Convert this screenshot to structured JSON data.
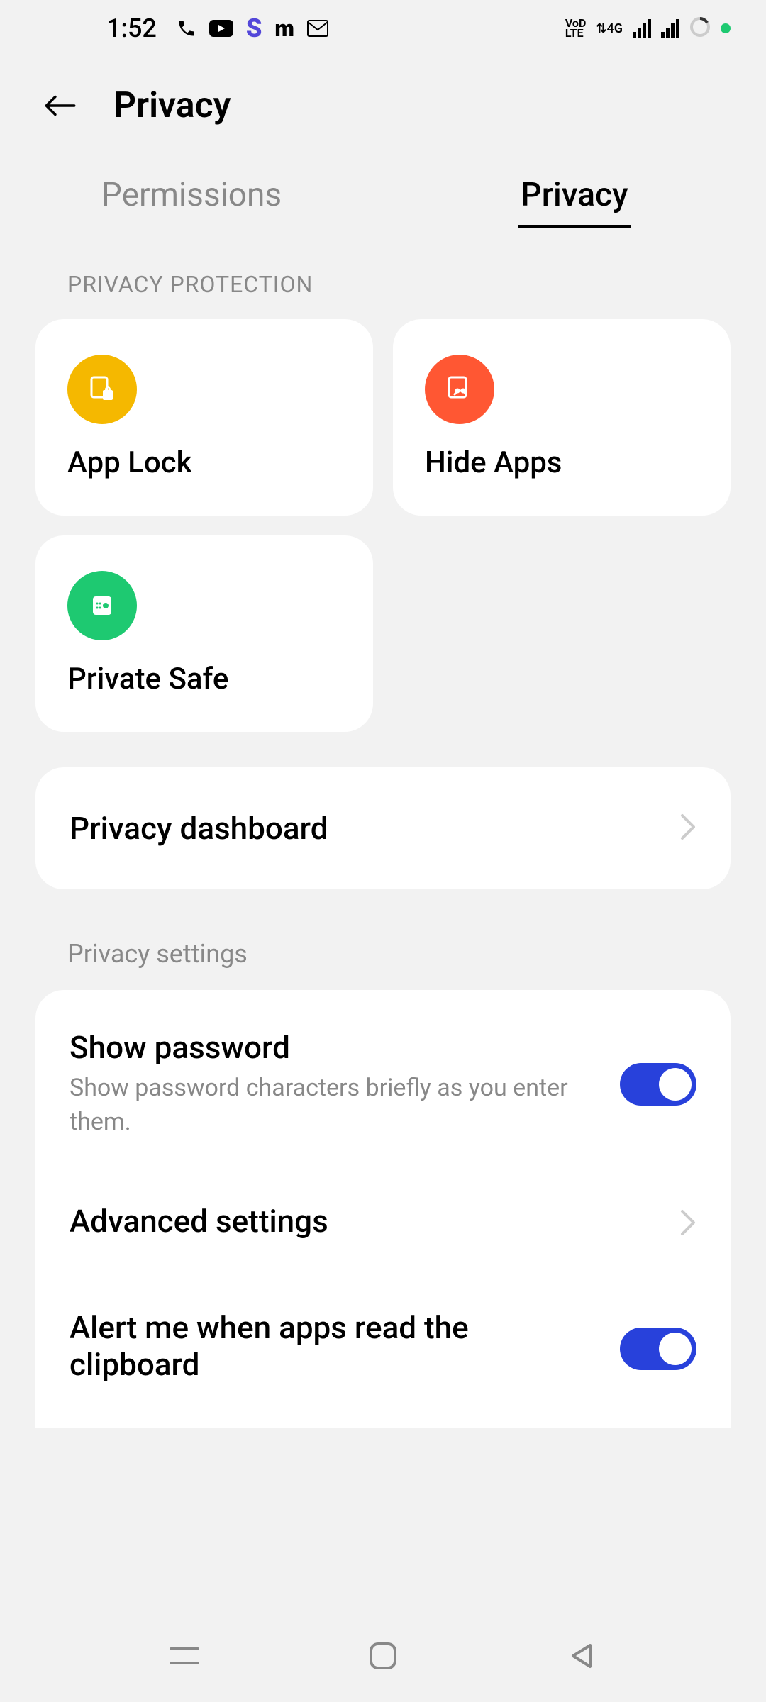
{
  "status": {
    "time": "1:52",
    "network_label": "VoLTE",
    "network_4g": "4G"
  },
  "header": {
    "title": "Privacy"
  },
  "tabs": {
    "permissions": "Permissions",
    "privacy": "Privacy"
  },
  "section1_label": "PRIVACY PROTECTION",
  "cards": {
    "app_lock": "App Lock",
    "hide_apps": "Hide Apps",
    "private_safe": "Private Safe"
  },
  "dashboard": {
    "title": "Privacy dashboard"
  },
  "section2_label": "Privacy settings",
  "settings": {
    "show_password": {
      "title": "Show password",
      "desc": "Show password characters briefly as you enter them.",
      "enabled": true
    },
    "advanced": {
      "title": "Advanced settings"
    },
    "clipboard": {
      "title": "Alert me when apps read the clipboard",
      "enabled": true
    }
  },
  "colors": {
    "app_lock_icon": "#f5b800",
    "hide_apps_icon": "#ff5733",
    "private_safe_icon": "#1ec971",
    "toggle_on": "#2841db"
  }
}
